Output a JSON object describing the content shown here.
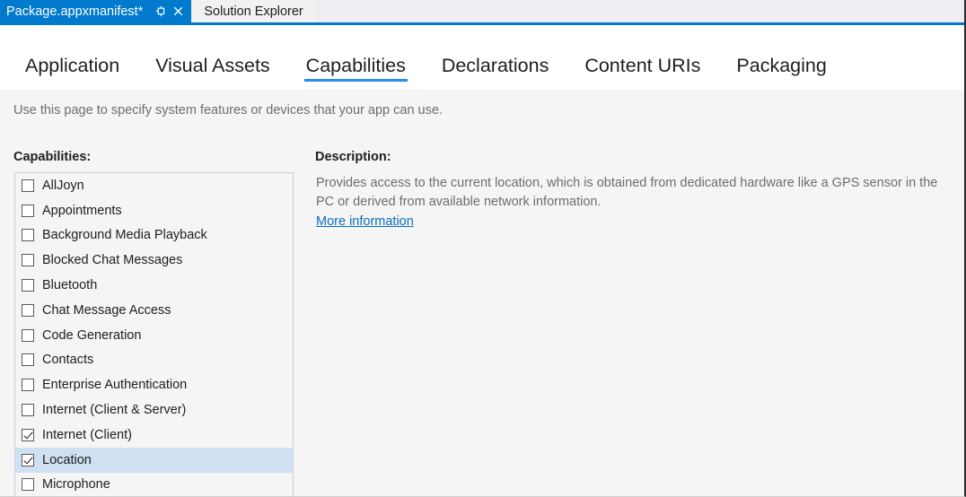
{
  "window": {
    "document_tabs": [
      {
        "title": "Package.appxmanifest*",
        "active": true,
        "pin_icon": "pin-icon",
        "close_icon": "close-icon"
      },
      {
        "title": "Solution Explorer",
        "active": false
      }
    ]
  },
  "page_tabs": [
    {
      "label": "Application",
      "selected": false
    },
    {
      "label": "Visual Assets",
      "selected": false
    },
    {
      "label": "Capabilities",
      "selected": true
    },
    {
      "label": "Declarations",
      "selected": false
    },
    {
      "label": "Content URIs",
      "selected": false
    },
    {
      "label": "Packaging",
      "selected": false
    }
  ],
  "hint": "Use this page to specify system features or devices that your app can use.",
  "capabilities": {
    "label": "Capabilities:",
    "items": [
      {
        "label": "AllJoyn",
        "checked": false,
        "selected": false
      },
      {
        "label": "Appointments",
        "checked": false,
        "selected": false
      },
      {
        "label": "Background Media Playback",
        "checked": false,
        "selected": false
      },
      {
        "label": "Blocked Chat Messages",
        "checked": false,
        "selected": false
      },
      {
        "label": "Bluetooth",
        "checked": false,
        "selected": false
      },
      {
        "label": "Chat Message Access",
        "checked": false,
        "selected": false
      },
      {
        "label": "Code Generation",
        "checked": false,
        "selected": false
      },
      {
        "label": "Contacts",
        "checked": false,
        "selected": false
      },
      {
        "label": "Enterprise Authentication",
        "checked": false,
        "selected": false
      },
      {
        "label": "Internet (Client & Server)",
        "checked": false,
        "selected": false
      },
      {
        "label": "Internet (Client)",
        "checked": true,
        "selected": false
      },
      {
        "label": "Location",
        "checked": true,
        "selected": true
      },
      {
        "label": "Microphone",
        "checked": false,
        "selected": false
      }
    ]
  },
  "description": {
    "label": "Description:",
    "text": "Provides access to the current location, which is obtained from dedicated hardware like a GPS sensor in the PC or derived from available network information.",
    "link_label": "More information"
  },
  "colors": {
    "accent_blue": "#007acc",
    "tab_underline_blue": "#2a8ce8",
    "selection_blue": "#cfe0f3",
    "link_blue": "#0a6ebd",
    "panel_gray": "#f5f5f5",
    "list_border": "#cdcdd8"
  }
}
